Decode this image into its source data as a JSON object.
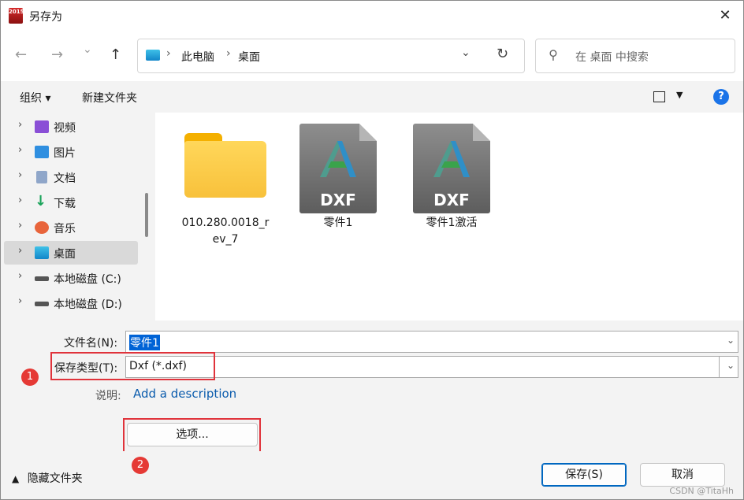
{
  "window": {
    "title": "另存为",
    "app_icon_text": "2015"
  },
  "nav": {
    "back": "←",
    "forward": "→",
    "recent": "⌄",
    "up": "↑",
    "path": [
      "此电脑",
      "桌面"
    ],
    "search_placeholder": "在 桌面 中搜索"
  },
  "toolbar": {
    "organize": "组织 ▾",
    "new_folder": "新建文件夹",
    "help": "?"
  },
  "sidebar": {
    "items": [
      {
        "label": "视频",
        "icon": "video-icon",
        "color": "#8a4fd6"
      },
      {
        "label": "图片",
        "icon": "pictures-icon",
        "color": "#2f8fe0"
      },
      {
        "label": "文档",
        "icon": "documents-icon",
        "color": "#6f8fb5"
      },
      {
        "label": "下载",
        "icon": "download-icon",
        "color": "#1aa35a"
      },
      {
        "label": "音乐",
        "icon": "music-icon",
        "color": "#e8643b"
      },
      {
        "label": "桌面",
        "icon": "desktop-icon",
        "color": "#1a9ee0",
        "selected": true
      },
      {
        "label": "本地磁盘 (C:)",
        "icon": "drive-c-icon",
        "color": "#555555"
      },
      {
        "label": "本地磁盘 (D:)",
        "icon": "drive-d-icon",
        "color": "#555555"
      }
    ]
  },
  "files": [
    {
      "name": "010.280.0018_rev_7",
      "line1": "010.280.0018_r",
      "line2": "ev_7",
      "type": "folder"
    },
    {
      "name": "零件1",
      "type": "dxf",
      "badge": "DXF"
    },
    {
      "name": "零件1激活",
      "type": "dxf",
      "badge": "DXF"
    }
  ],
  "form": {
    "filename_label": "文件名(N):",
    "filename_value": "零件1",
    "filetype_label": "保存类型(T):",
    "filetype_value": "Dxf (*.dxf)",
    "description_label": "说明:",
    "description_link": "Add a description",
    "options_button": "选项...",
    "badge1": "1",
    "badge2": "2"
  },
  "footer": {
    "hide_folders": "隐藏文件夹",
    "save": "保存(S)",
    "cancel": "取消",
    "watermark": "CSDN @TitaHh"
  }
}
